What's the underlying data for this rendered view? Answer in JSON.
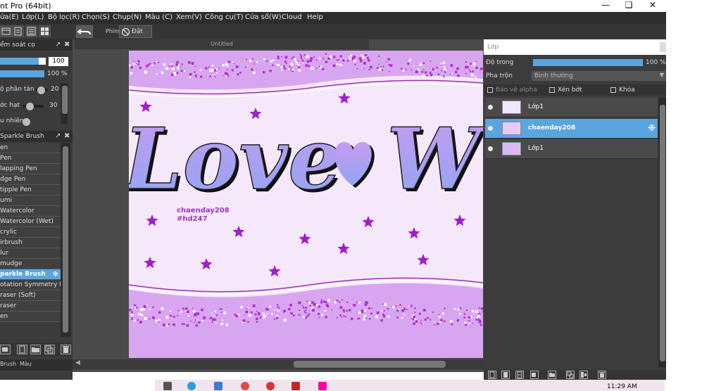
{
  "window": {
    "title": "nt Pro (64bit)",
    "min_icon": "minimize-icon",
    "max_icon": "restore-icon",
    "close_icon": "close-icon"
  },
  "menu": [
    "ửa(E)",
    "Lớp(L)",
    "Bộ lọc(R)",
    "Chọn(S)",
    "Chụp(N)",
    "Màu (C)",
    "Xem(V)",
    "Công cụ(T)",
    "Cửa sổ(W)",
    "Cloud",
    "Help"
  ],
  "toolbar": {
    "phim_label": "Phím",
    "reset_label": "Đặt lại"
  },
  "brush_control": {
    "title": "ểm soát cọ",
    "size_value": "100",
    "opacity_value": "100 %",
    "scatter_label": "ộ phân tán",
    "scatter_value": "20",
    "grain_label": "ớc hạt",
    "grain_value": "30",
    "random_label": "u nhiên"
  },
  "brush_panel": {
    "title": "Sparkle Brush",
    "items": [
      "en",
      " Pen",
      "lapping Pen",
      "dge Pen",
      "tipple Pen",
      "umi",
      "Watercolor",
      "Watercolor (Wet)",
      "crylic",
      "irbrush",
      "lur",
      "mudge",
      "parkle Brush",
      "otation Symmetry Pe",
      "raser (Soft)",
      "raser",
      "en"
    ],
    "selected_index": 12
  },
  "left_tabs": [
    "Brush",
    "Màu"
  ],
  "canvas": {
    "doc_title": "Untitled",
    "art_text": "Love",
    "art_text2": "W",
    "signature_line1": "chaenday208",
    "signature_line2": "#hd247",
    "colors": {
      "bg_light": "#f6e8fb",
      "band": "#d8a6f0",
      "sparkle": "#b52fd0",
      "star": "#a020c8",
      "text_fill_top": "#c79bf0",
      "text_fill_bottom": "#8fa6f2"
    }
  },
  "layer_panel": {
    "title": "Lớp",
    "opacity_label": "Độ trong",
    "opacity_value": "100 %",
    "blend_label": "Pha trộn",
    "blend_value": "Bình thường",
    "protect_alpha": "Bảo vệ alpha",
    "clipping": "Xén bớt",
    "lock": "Khóa",
    "layers": [
      {
        "name": "Lớp1",
        "selected": false
      },
      {
        "name": "chaenday208",
        "selected": true
      },
      {
        "name": "Lớp1",
        "selected": false
      }
    ]
  },
  "taskbar": {
    "clock": "11:29 AM"
  }
}
